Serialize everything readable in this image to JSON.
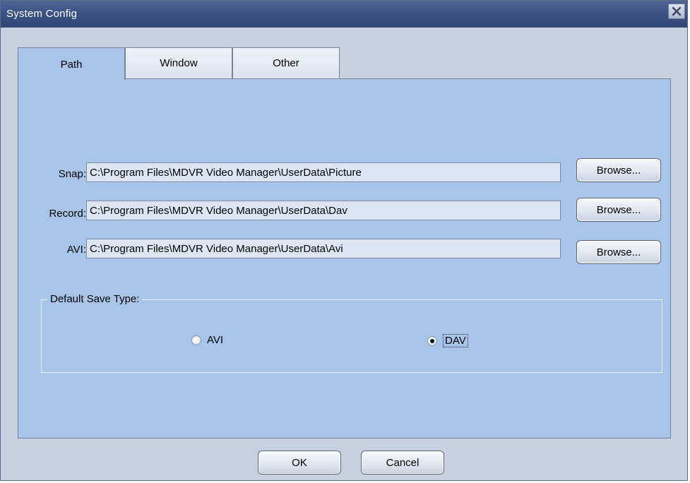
{
  "window": {
    "title": "System Config",
    "close_icon": "close-icon"
  },
  "tabs": [
    {
      "label": "Path",
      "active": true
    },
    {
      "label": "Window",
      "active": false
    },
    {
      "label": "Other",
      "active": false
    }
  ],
  "paths": {
    "snap": {
      "label": "Snap:",
      "value": "C:\\Program Files\\MDVR Video Manager\\UserData\\Picture",
      "browse": "Browse..."
    },
    "record": {
      "label": "Record:",
      "value": "C:\\Program Files\\MDVR Video Manager\\UserData\\Dav",
      "browse": "Browse..."
    },
    "avi": {
      "label": "AVI:",
      "value": "C:\\Program Files\\MDVR Video Manager\\UserData\\Avi",
      "browse": "Browse..."
    }
  },
  "save_type": {
    "legend": "Default Save Type:",
    "options": [
      {
        "label": "AVI",
        "checked": false
      },
      {
        "label": "DAV",
        "checked": true
      }
    ]
  },
  "footer": {
    "ok": "OK",
    "cancel": "Cancel"
  },
  "colors": {
    "titlebar": "#3a5183",
    "panel": "#a8c4e8",
    "window_bg": "#c6d0e1"
  }
}
